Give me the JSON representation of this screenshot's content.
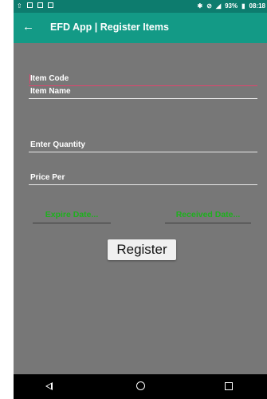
{
  "status_bar": {
    "battery": "93%",
    "time": "08:18",
    "icons": [
      "upload-icon",
      "gallery-icon",
      "sim-icon",
      "lock-icon",
      "bluetooth-icon",
      "do-not-disturb-icon",
      "signal-icon",
      "battery-icon"
    ]
  },
  "app_bar": {
    "back_icon": "←",
    "title": "EFD App | Register Items",
    "background": "#139a86"
  },
  "form": {
    "item_code": {
      "placeholder": "Item Code"
    },
    "item_name": {
      "placeholder": "Item Name"
    },
    "quantity": {
      "placeholder": "Enter Quantity"
    },
    "price": {
      "placeholder": "Price Per"
    },
    "expire_date_label": "Expire Date...",
    "received_date_label": "Received Date...",
    "register_label": "Register"
  },
  "colors": {
    "accent": "#e0456d",
    "date_text": "#1eb01e",
    "screen_bg": "#777777"
  },
  "nav_bar": {
    "icons": [
      "back-triangle-icon",
      "home-circle-icon",
      "recents-square-icon"
    ]
  }
}
